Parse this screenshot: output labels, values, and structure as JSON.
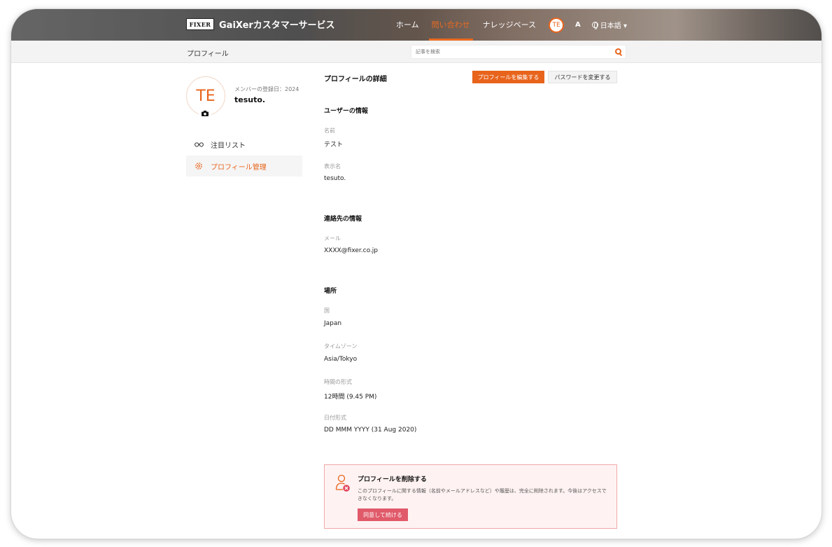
{
  "header": {
    "logo_text": "FIXER",
    "brand": "GaiXerカスタマーサービス",
    "nav": [
      "ホーム",
      "問い合わせ",
      "ナレッジベース"
    ],
    "active_nav": "問い合わせ",
    "avatar_initials": "TE",
    "font_icon": "A",
    "language": "日本語 ▾"
  },
  "subbar": {
    "breadcrumb": "プロフィール",
    "search_placeholder": "記事を検索"
  },
  "sidebar": {
    "avatar_initials": "TE",
    "member_since": "メンバーの登録日：2024",
    "username": "tesuto.",
    "items": [
      {
        "label": "注目リスト",
        "icon": "glasses-icon"
      },
      {
        "label": "プロフィール管理",
        "icon": "gear-icon"
      }
    ]
  },
  "main": {
    "title": "プロフィールの詳細",
    "edit_button": "プロフィールを編集する",
    "password_button": "パスワードを変更する",
    "user_info": {
      "heading": "ユーザーの情報",
      "name_label": "名前",
      "name_value": "テスト",
      "display_label": "表示名",
      "display_value": "tesuto."
    },
    "contact": {
      "heading": "連絡先の情報",
      "email_label": "メール",
      "email_value": "XXXX@fixer.co.jp"
    },
    "location": {
      "heading": "場所",
      "country_label": "国",
      "country_value": "Japan",
      "tz_label": "タイムゾーン",
      "tz_value": "Asia/Tokyo",
      "time_label": "時間の形式",
      "time_value": "12時間 (9.45 PM)",
      "date_label": "日付形式",
      "date_value": "DD MMM YYYY (31 Aug 2020)"
    },
    "delete": {
      "title": "プロフィールを削除する",
      "description": "このプロフィールに関する情報（名前やメールアドレスなど）や履歴は、完全に削除されます。今後はアクセスできなくなります。",
      "button": "同意して続ける"
    }
  },
  "colors": {
    "accent": "#e8641c",
    "danger": "#e05a6a",
    "danger_bg": "#fff2f2"
  }
}
